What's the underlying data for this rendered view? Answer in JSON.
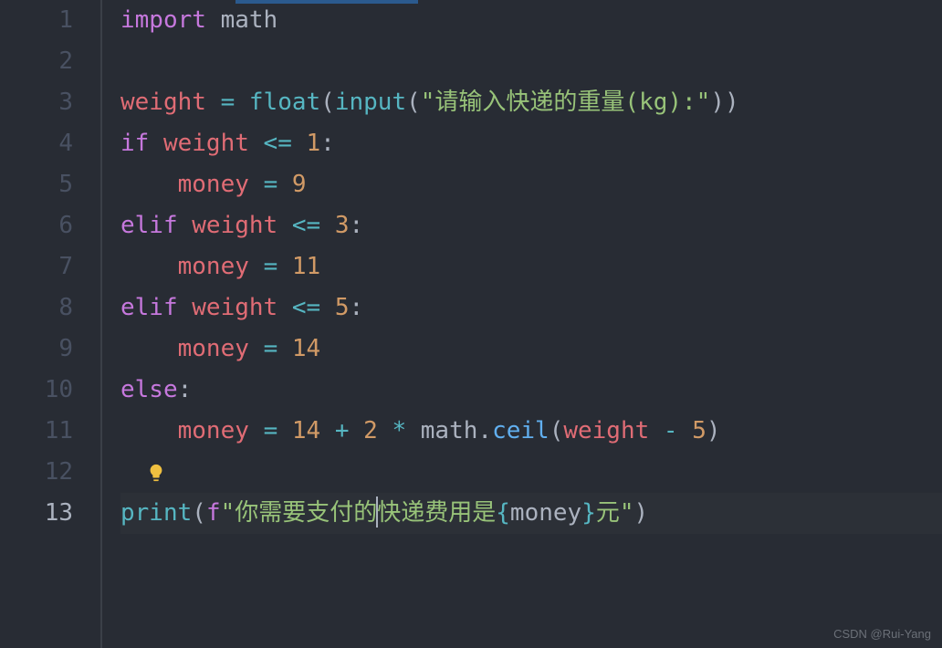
{
  "lines": {
    "1": {
      "import": "import",
      "module": "math"
    },
    "2": {
      "empty": ""
    },
    "3": {
      "var": "weight",
      "eq": "=",
      "float": "float",
      "input": "input",
      "str": "\"请输入快递的重量(kg):\""
    },
    "4": {
      "if": "if",
      "var": "weight",
      "op": "<=",
      "num": "1"
    },
    "5": {
      "var": "money",
      "eq": "=",
      "num": "9"
    },
    "6": {
      "elif": "elif",
      "var": "weight",
      "op": "<=",
      "num": "3"
    },
    "7": {
      "var": "money",
      "eq": "=",
      "num": "11"
    },
    "8": {
      "elif": "elif",
      "var": "weight",
      "op": "<=",
      "num": "5"
    },
    "9": {
      "var": "money",
      "eq": "=",
      "num": "14"
    },
    "10": {
      "else": "else"
    },
    "11": {
      "var": "money",
      "eq": "=",
      "n1": "14",
      "plus": "+",
      "n2": "2",
      "star": "*",
      "mod": "math",
      "method": "ceil",
      "wvar": "weight",
      "minus": "-",
      "n3": "5"
    },
    "12": {
      "empty": ""
    },
    "13": {
      "print": "print",
      "f": "f",
      "s1": "\"你需要支付的",
      "s2": "快递费用是",
      "lb": "{",
      "mv": "money",
      "rb": "}",
      "s3": "元\""
    }
  },
  "gutter": [
    "1",
    "2",
    "3",
    "4",
    "5",
    "6",
    "7",
    "8",
    "9",
    "10",
    "11",
    "12",
    "13"
  ],
  "watermark": "CSDN @Rui-Yang"
}
